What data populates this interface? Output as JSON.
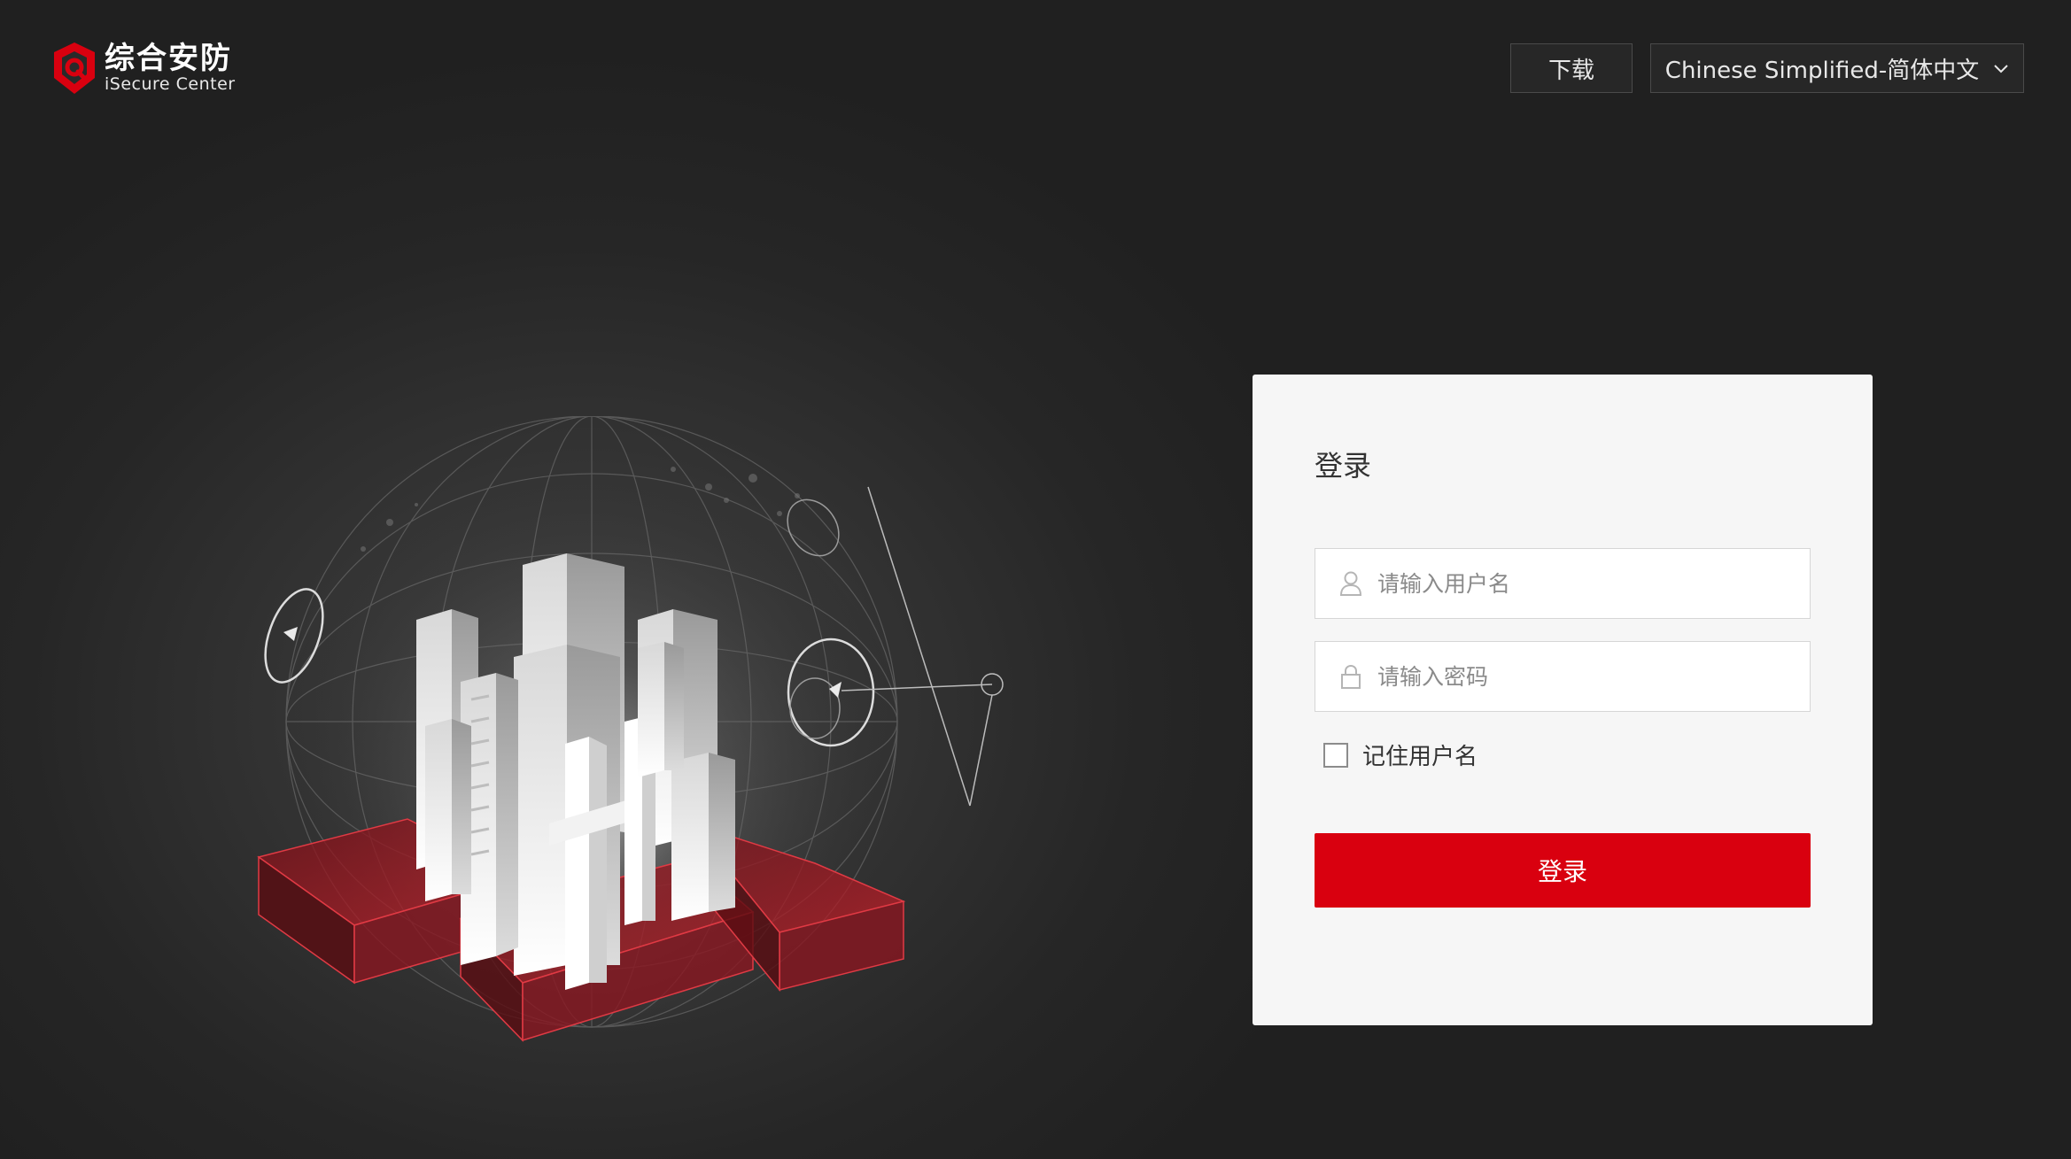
{
  "header": {
    "logo_cn": "综合安防",
    "logo_en": "iSecure Center",
    "download_label": "下载",
    "language_selected": "Chinese Simplified-简体中文"
  },
  "login": {
    "title": "登录",
    "username_placeholder": "请输入用户名",
    "password_placeholder": "请输入密码",
    "remember_label": "记住用户名",
    "remember_checked": false,
    "submit_label": "登录"
  },
  "colors": {
    "accent": "#d9000f",
    "background": "#2a2a2a",
    "card": "#f6f6f6"
  },
  "icons": {
    "logo": "shield-logo-icon",
    "language": "chevron-down-icon",
    "username": "user-icon",
    "password": "lock-icon"
  }
}
